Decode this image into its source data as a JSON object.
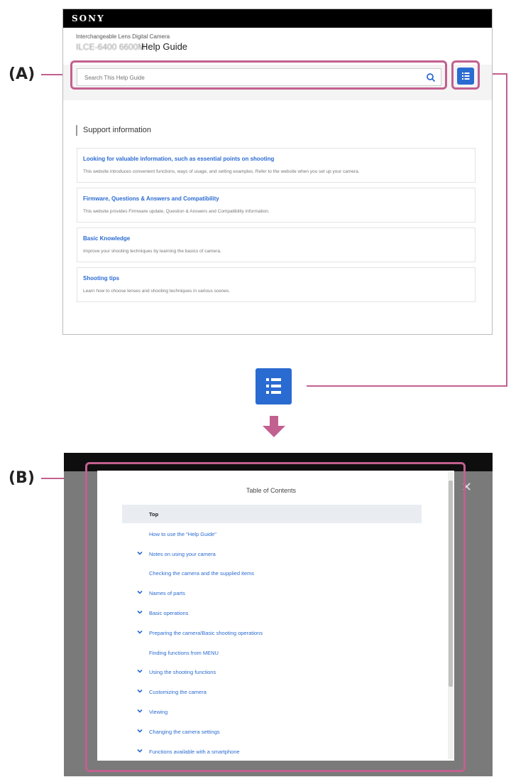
{
  "labels": {
    "a": "(A)",
    "b": "(B)"
  },
  "help_page": {
    "brand": "SONY",
    "subtitle": "Interchangeable Lens Digital Camera",
    "model": "ILCE-6400 6600M",
    "title": "Help Guide",
    "search": {
      "placeholder": "Search This Help Guide",
      "icon": "search-icon"
    },
    "toc_button_icon": "list-icon",
    "support_heading": "Support information",
    "cards": [
      {
        "title": "Looking for valuable information, such as essential points on shooting",
        "desc": "This website introduces convenient functions, ways of usage, and setting examples. Refer to the website when you set up your camera."
      },
      {
        "title": "Firmware, Questions & Answers and Compatibility",
        "desc": "This website provides Firmware update, Question & Answers and Compatibility information."
      },
      {
        "title": "Basic Knowledge",
        "desc": "Improve your shooting techniques by learning the basics of camera."
      },
      {
        "title": "Shooting tips",
        "desc": "Learn how to choose lenses and shooting techniques in various scenes."
      }
    ]
  },
  "toc_modal": {
    "title": "Table of Contents",
    "close_icon": "close-icon",
    "items": [
      {
        "label": "Top",
        "expandable": false,
        "active": true
      },
      {
        "label": "How to use the \"Help Guide\"",
        "expandable": false,
        "active": false
      },
      {
        "label": "Notes on using your camera",
        "expandable": true,
        "active": false
      },
      {
        "label": "Checking the camera and the supplied items",
        "expandable": false,
        "active": false
      },
      {
        "label": "Names of parts",
        "expandable": true,
        "active": false
      },
      {
        "label": "Basic operations",
        "expandable": true,
        "active": false
      },
      {
        "label": "Preparing the camera/Basic shooting operations",
        "expandable": true,
        "active": false
      },
      {
        "label": "Finding functions from MENU",
        "expandable": false,
        "active": false
      },
      {
        "label": "Using the shooting functions",
        "expandable": true,
        "active": false
      },
      {
        "label": "Customizing the camera",
        "expandable": true,
        "active": false
      },
      {
        "label": "Viewing",
        "expandable": true,
        "active": false
      },
      {
        "label": "Changing the camera settings",
        "expandable": true,
        "active": false
      },
      {
        "label": "Functions available with a smartphone",
        "expandable": true,
        "active": false
      }
    ]
  },
  "colors": {
    "accent": "#2a6bd1",
    "callout": "#c2608f",
    "sony_bar": "#000000"
  }
}
